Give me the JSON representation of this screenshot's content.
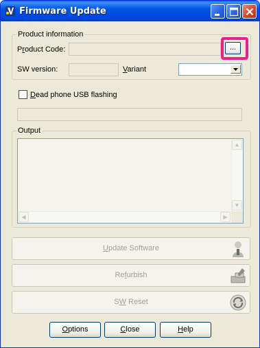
{
  "window": {
    "title": "Firmware Update",
    "controls": {
      "minimize": "minimize-icon",
      "maximize": "maximize-icon",
      "close": "close-icon"
    }
  },
  "product_info": {
    "group_label": "Product information",
    "product_code_label_pre": "P",
    "product_code_label_ul": "r",
    "product_code_label_post": "oduct Code:",
    "product_code_value": "",
    "browse_label": "...",
    "sw_version_label": "SW version:",
    "sw_version_value": "",
    "variant_label_ul": "V",
    "variant_label_post": "ariant",
    "variant_value": ""
  },
  "dead_phone": {
    "label_ul": "D",
    "label_post": "ead phone USB flashing",
    "checked": false
  },
  "progress": {
    "value": 0
  },
  "output": {
    "group_label": "Output",
    "content": ""
  },
  "actions": {
    "update_ul": "U",
    "update_post": "pdate Software",
    "refurbish_pre": "Re",
    "refurbish_ul": "f",
    "refurbish_post": "urbish",
    "swreset_pre": "S",
    "swreset_ul": "W",
    "swreset_post": " Reset",
    "update_icon": "person-icon",
    "refurbish_icon": "tools-icon",
    "swreset_icon": "reset-icon"
  },
  "footer": {
    "options_ul": "O",
    "options_post": "ptions",
    "close_ul": "C",
    "close_post": "lose",
    "help_ul": "H",
    "help_post": "elp"
  },
  "colors": {
    "highlight": "#ee1e8c",
    "titlebar": "#0055e5"
  }
}
